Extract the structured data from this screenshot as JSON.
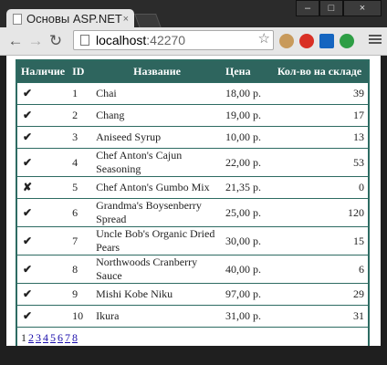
{
  "browser": {
    "tab_title": "Основы ASP.NET",
    "tab_close": "×",
    "url_host": "localhost",
    "url_port": ":42270",
    "window_buttons": {
      "minimize": "–",
      "maximize": "□",
      "close": "×"
    }
  },
  "table": {
    "headers": {
      "available": "Наличие",
      "id": "ID",
      "name": "Название",
      "price": "Цена",
      "stock": "Кол-во на складе"
    },
    "rows": [
      {
        "mark": "✔",
        "id": "1",
        "name": "Chai",
        "price": "18,00 р.",
        "stock": "39"
      },
      {
        "mark": "✔",
        "id": "2",
        "name": "Chang",
        "price": "19,00 р.",
        "stock": "17"
      },
      {
        "mark": "✔",
        "id": "3",
        "name": "Aniseed Syrup",
        "price": "10,00 р.",
        "stock": "13"
      },
      {
        "mark": "✔",
        "id": "4",
        "name": "Chef Anton's Cajun Seasoning",
        "price": "22,00 р.",
        "stock": "53"
      },
      {
        "mark": "✘",
        "id": "5",
        "name": "Chef Anton's Gumbo Mix",
        "price": "21,35 р.",
        "stock": "0"
      },
      {
        "mark": "✔",
        "id": "6",
        "name": "Grandma's Boysenberry Spread",
        "price": "25,00 р.",
        "stock": "120"
      },
      {
        "mark": "✔",
        "id": "7",
        "name": "Uncle Bob's Organic Dried Pears",
        "price": "30,00 р.",
        "stock": "15"
      },
      {
        "mark": "✔",
        "id": "8",
        "name": "Northwoods Cranberry Sauce",
        "price": "40,00 р.",
        "stock": "6"
      },
      {
        "mark": "✔",
        "id": "9",
        "name": "Mishi Kobe Niku",
        "price": "97,00 р.",
        "stock": "29"
      },
      {
        "mark": "✔",
        "id": "10",
        "name": "Ikura",
        "price": "31,00 р.",
        "stock": "31"
      }
    ],
    "pager": {
      "current": "1",
      "pages": [
        "2",
        "3",
        "4",
        "5",
        "6",
        "7",
        "8"
      ]
    }
  },
  "colors": {
    "header_bg": "#2e655e",
    "check": "#1f8a2d",
    "cross": "#c51c1c",
    "link": "#1a0dab"
  }
}
